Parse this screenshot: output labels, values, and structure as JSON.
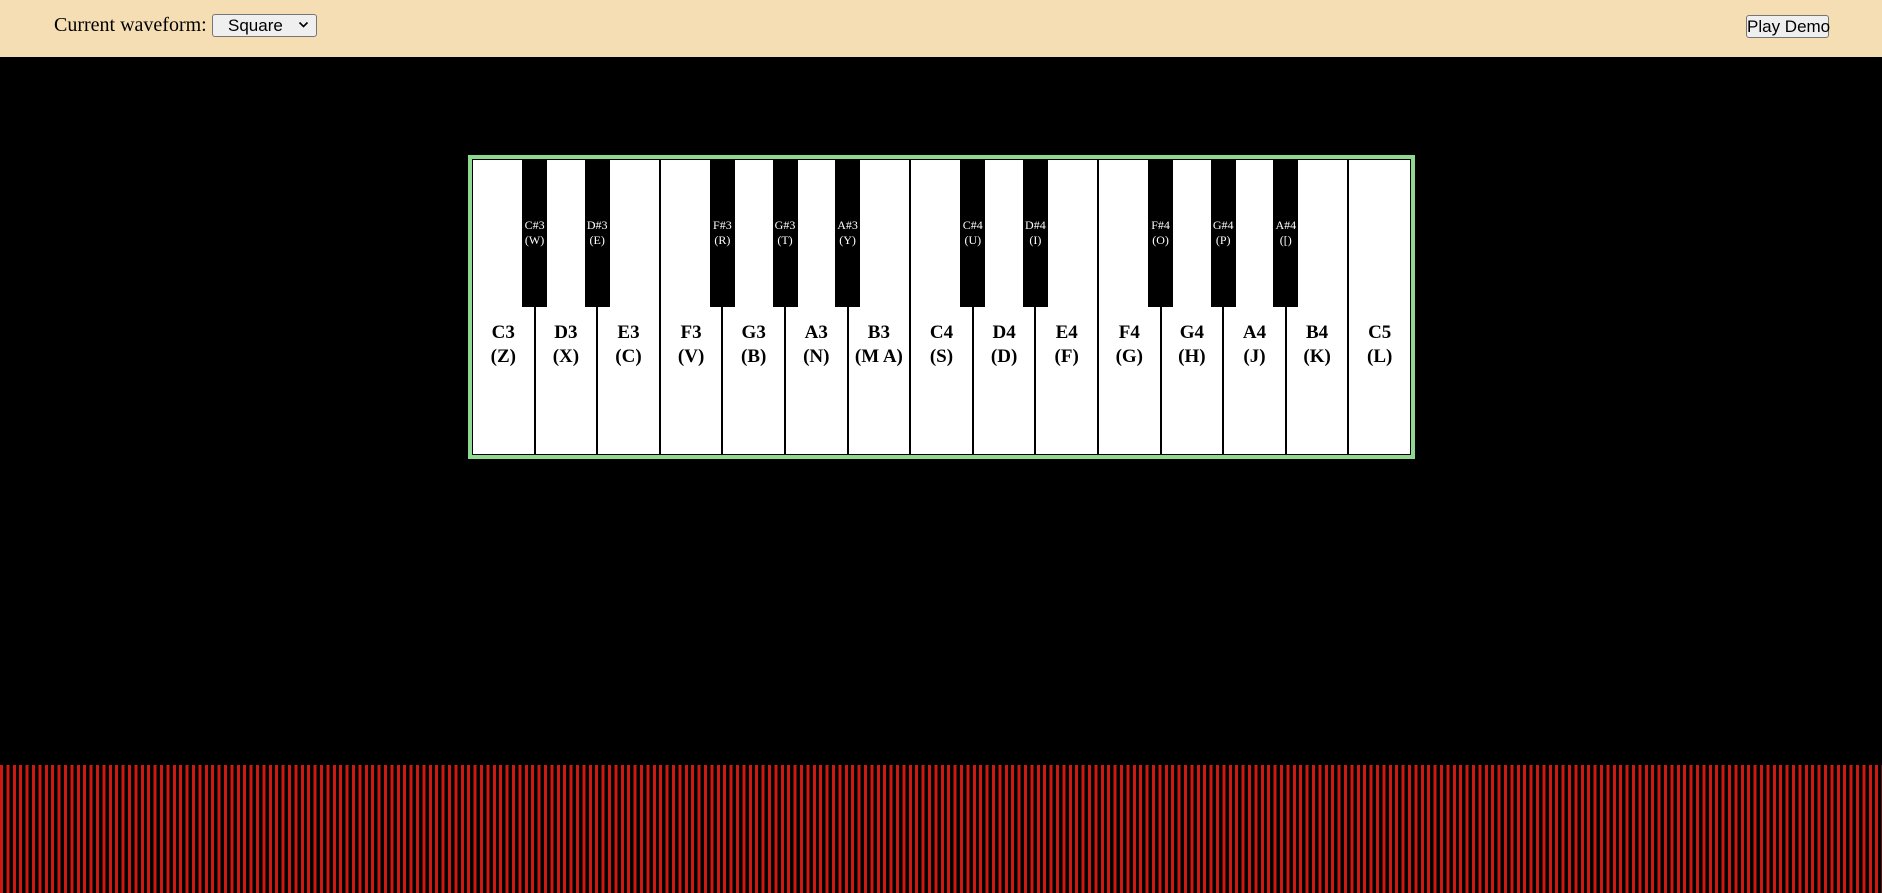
{
  "toolbar": {
    "waveform_label": "Current waveform:",
    "waveform_selected": "Square",
    "demo_button": "Play Demo"
  },
  "keyboard": {
    "white_keys": [
      {
        "note": "C3",
        "key": "(Z)"
      },
      {
        "note": "D3",
        "key": "(X)"
      },
      {
        "note": "E3",
        "key": "(C)"
      },
      {
        "note": "F3",
        "key": "(V)"
      },
      {
        "note": "G3",
        "key": "(B)"
      },
      {
        "note": "A3",
        "key": "(N)"
      },
      {
        "note": "B3",
        "key": "(M A)"
      },
      {
        "note": "C4",
        "key": "(S)"
      },
      {
        "note": "D4",
        "key": "(D)"
      },
      {
        "note": "E4",
        "key": "(F)"
      },
      {
        "note": "F4",
        "key": "(G)"
      },
      {
        "note": "G4",
        "key": "(H)"
      },
      {
        "note": "A4",
        "key": "(J)"
      },
      {
        "note": "B4",
        "key": "(K)"
      },
      {
        "note": "C5",
        "key": "(L)"
      }
    ],
    "black_keys": [
      {
        "note": "C#3",
        "key": "(W)"
      },
      {
        "note": "D#3",
        "key": "(E)"
      },
      {
        "note": "F#3",
        "key": "(R)"
      },
      {
        "note": "G#3",
        "key": "(T)"
      },
      {
        "note": "A#3",
        "key": "(Y)"
      },
      {
        "note": "C#4",
        "key": "(U)"
      },
      {
        "note": "D#4",
        "key": "(I)"
      },
      {
        "note": "F#4",
        "key": "(O)"
      },
      {
        "note": "G#4",
        "key": "(P)"
      },
      {
        "note": "A#4",
        "key": "([)"
      }
    ]
  },
  "colors": {
    "toolbar_background": "#f5deb3",
    "page_background": "#000000",
    "keyboard_border": "#8fd88f",
    "visualizer_bars": "#cc1a12"
  },
  "icons": {
    "select_arrow": "chevron-down-icon"
  }
}
